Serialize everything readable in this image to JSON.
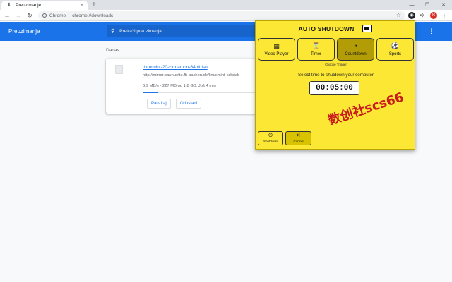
{
  "browser": {
    "tab_title": "Preuzimanje",
    "tab_close": "×",
    "new_tab": "+",
    "omnibox_scheme": "Chrome",
    "omnibox_url": "chrome://downloads",
    "window_controls": [
      "—",
      "❐",
      "✕"
    ],
    "avatar_initial": "B"
  },
  "downloads": {
    "title": "Preuzimanje",
    "search_placeholder": "Pretraži preuzimanja",
    "section_label": "Danas",
    "item": {
      "file_name": "linuxmint-20-cinnamon-64bit.iso",
      "url": "http://mirror.bauhuette.fh-aachen.de/linuxmint-cd/stab",
      "status": "6,9 MB/s - 227 MB od 1,8 GB, Još 4 min",
      "progress": 0.12,
      "pause_label": "Pauziraj",
      "cancel_label": "Odustani"
    }
  },
  "popup": {
    "title": "AUTO SHUTDOWN",
    "triggers": [
      {
        "label": "Video Player",
        "icon": "film-icon",
        "active": false
      },
      {
        "label": "Timer",
        "icon": "hourglass-icon",
        "active": false
      },
      {
        "label": "Countdown",
        "icon": "countdown-icon",
        "active": true
      },
      {
        "label": "Sports",
        "icon": "soccer-ball-icon",
        "active": false
      }
    ],
    "choose_label": "Choose Trigger",
    "select_label": "Select time to shutdown your computer",
    "time_value": "00:05:00",
    "shutdown_label": "Shutdown",
    "cancel_label": "Cancel",
    "watermark": "数创社scs66",
    "colors": {
      "background": "#fde735",
      "active_trigger": "#b39d06",
      "cancel_button": "#d9c200",
      "watermark": "#c81b1b"
    }
  },
  "colors": {
    "accent": "#1a73e8"
  }
}
